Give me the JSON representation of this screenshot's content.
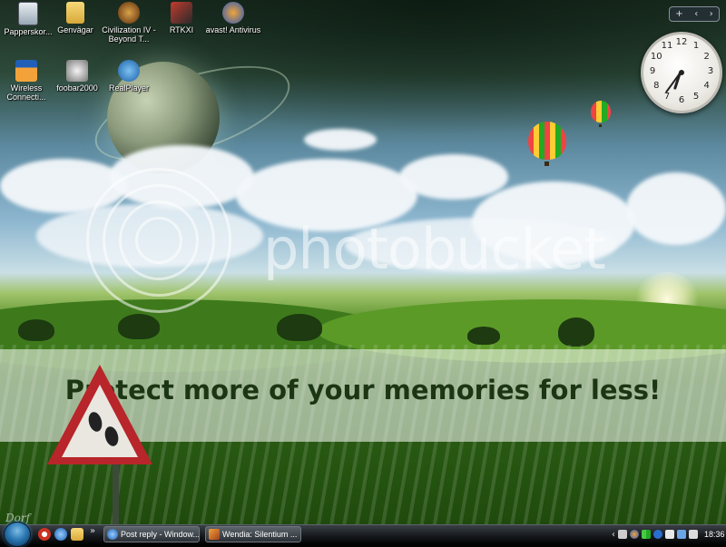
{
  "desktop": {
    "icons": [
      {
        "label": "Papperskor...",
        "icon": "recycle-bin-icon"
      },
      {
        "label": "Genvägar",
        "icon": "folder-icon"
      },
      {
        "label": "Civilization IV - Beyond T...",
        "icon": "civilization-icon"
      },
      {
        "label": "RTKXI",
        "icon": "rtkxi-icon"
      },
      {
        "label": "avast! Antivirus",
        "icon": "avast-icon"
      },
      {
        "label": "Wireless Connecti...",
        "icon": "dlink-wireless-icon"
      },
      {
        "label": "foobar2000",
        "icon": "foobar-icon"
      },
      {
        "label": "RealPlayer",
        "icon": "realplayer-icon"
      }
    ]
  },
  "sidebar": {
    "controls": [
      "+",
      "‹",
      "›"
    ],
    "clock": {
      "numbers": [
        "12",
        "1",
        "2",
        "3",
        "4",
        "5",
        "6",
        "7",
        "8",
        "9",
        "10",
        "11"
      ],
      "hour": 6,
      "minute": 36
    }
  },
  "watermark": {
    "brand": "photobucket",
    "tagline": "Protect more of your memories for less!",
    "signature": "Dorf"
  },
  "taskbar": {
    "quick_launch_more": "»",
    "tasks": [
      {
        "label": "Post reply - Window...",
        "icon": "internet-explorer-icon"
      },
      {
        "label": "Wendia: Silentium ...",
        "icon": "media-player-icon"
      }
    ],
    "tray": {
      "expand": "‹",
      "time": "18:36"
    }
  },
  "colors": {
    "sign_red": "#b8252a",
    "taskbar": "#15181b",
    "grass": "#2f6516"
  }
}
